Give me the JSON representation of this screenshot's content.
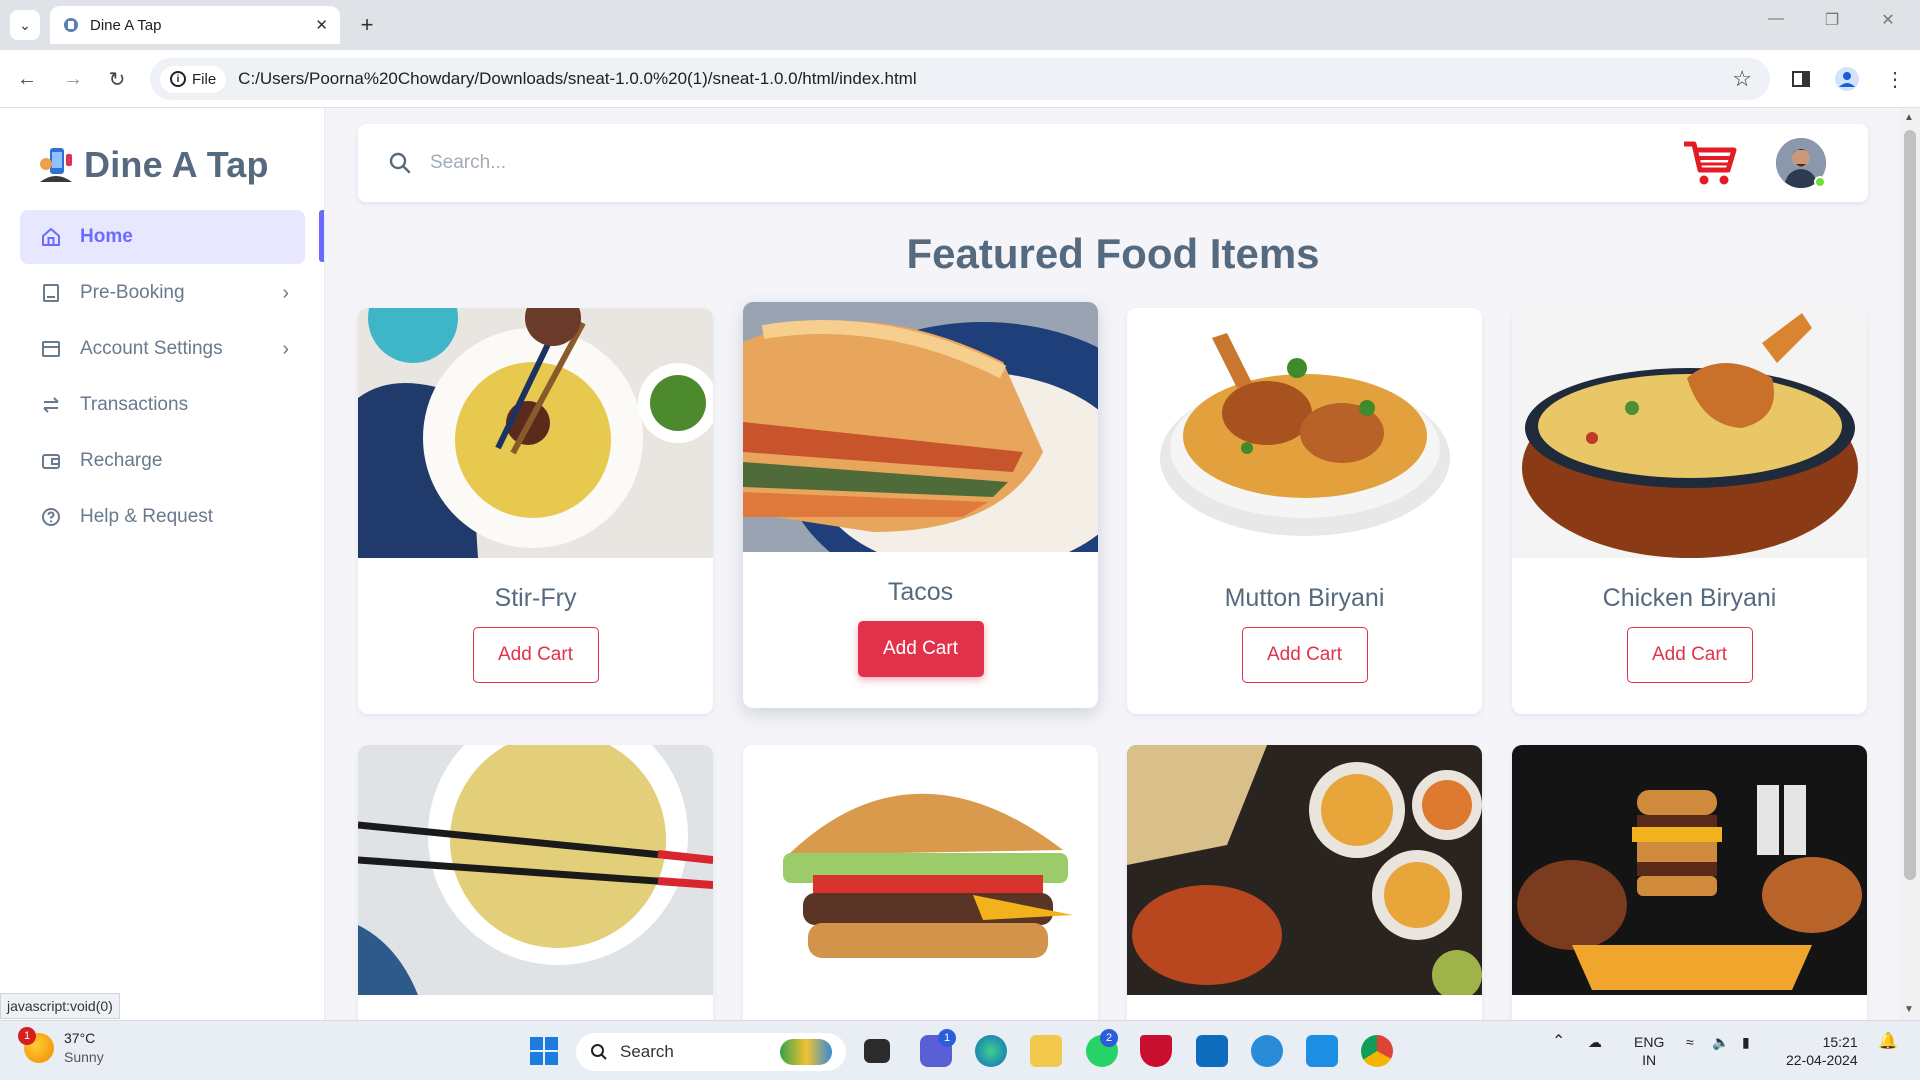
{
  "browser": {
    "tab_title": "Dine A Tap",
    "new_tab": "+",
    "url_chip": "File",
    "url": "C:/Users/Poorna%20Chowdary/Downloads/sneat-1.0.0%20(1)/sneat-1.0.0/html/index.html"
  },
  "brand": {
    "name": "Dine A Tap"
  },
  "sidebar": {
    "items": [
      {
        "label": "Home",
        "icon": "home-icon",
        "active": true
      },
      {
        "label": "Pre-Booking",
        "icon": "receipt-icon",
        "has_submenu": true
      },
      {
        "label": "Account Settings",
        "icon": "layout-icon",
        "has_submenu": true
      },
      {
        "label": "Transactions",
        "icon": "transfer-icon"
      },
      {
        "label": "Recharge",
        "icon": "wallet-icon"
      },
      {
        "label": "Help & Request",
        "icon": "help-circle-icon"
      }
    ]
  },
  "header": {
    "search_placeholder": "Search...",
    "cart_icon": "shopping-cart-icon",
    "cart_color": "#e31b23"
  },
  "main": {
    "title": "Featured Food Items",
    "items": [
      {
        "name": "Stir-Fry",
        "button": "Add Cart"
      },
      {
        "name": "Tacos",
        "button": "Add Cart",
        "hovered": true
      },
      {
        "name": "Mutton Biryani",
        "button": "Add Cart"
      },
      {
        "name": "Chicken Biryani",
        "button": "Add Cart"
      }
    ]
  },
  "status_tip": "javascript:void(0)",
  "colors": {
    "accent": "#696cff",
    "danger": "#e0334b",
    "text": "#566a7f"
  },
  "taskbar": {
    "weather_temp": "37°C",
    "weather_desc": "Sunny",
    "weather_badge": "1",
    "search_label": "Search",
    "teams_badge": "1",
    "whatsapp_badge": "2",
    "lang_top": "ENG",
    "lang_bottom": "IN",
    "time": "15:21",
    "date": "22-04-2024"
  }
}
